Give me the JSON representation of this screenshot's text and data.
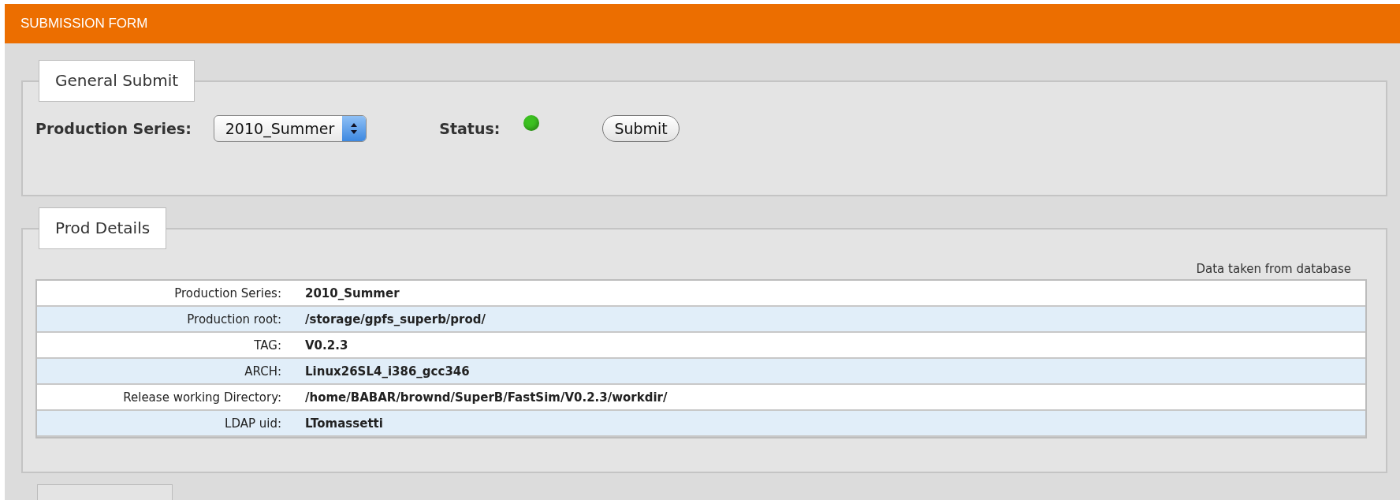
{
  "header": {
    "title": "SUBMISSION FORM"
  },
  "general_submit": {
    "legend": "General Submit",
    "series_label": "Production Series:",
    "series_select": {
      "value": "2010_Summer"
    },
    "status_label": "Status:",
    "status": {
      "on": true
    },
    "submit_button": "Submit"
  },
  "prod_details": {
    "legend": "Prod Details",
    "note": "Data taken from database",
    "rows": [
      {
        "label": "Production Series:",
        "value": "2010_Summer"
      },
      {
        "label": "Production root:",
        "value": "/storage/gpfs_superb/prod/"
      },
      {
        "label": "TAG:",
        "value": "V0.2.3"
      },
      {
        "label": "ARCH:",
        "value": "Linux26SL4_i386_gcc346"
      },
      {
        "label": "Release working Directory:",
        "value": "/home/BABAR/brownd/SuperB/FastSim/V0.2.3/workdir/"
      },
      {
        "label": "LDAP uid:",
        "value": "LTomassetti"
      }
    ]
  }
}
